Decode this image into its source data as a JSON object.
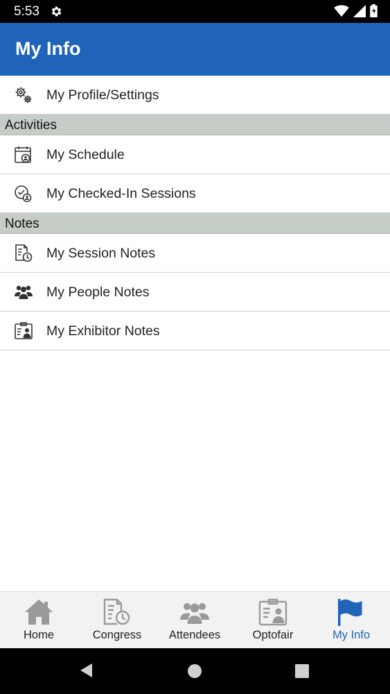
{
  "status_bar": {
    "time": "5:53"
  },
  "app_bar": {
    "title": "My Info"
  },
  "list": {
    "profile": {
      "label": "My Profile/Settings",
      "icon": "gears-icon"
    },
    "sections": [
      {
        "title": "Activities",
        "items": [
          {
            "label": "My Schedule",
            "icon": "calendar-person-icon"
          },
          {
            "label": "My Checked-In Sessions",
            "icon": "check-person-icon"
          }
        ]
      },
      {
        "title": "Notes",
        "items": [
          {
            "label": "My Session Notes",
            "icon": "note-clock-icon"
          },
          {
            "label": "My People Notes",
            "icon": "people-icon"
          },
          {
            "label": "My Exhibitor Notes",
            "icon": "exhibitor-card-icon"
          }
        ]
      }
    ]
  },
  "bottom_nav": {
    "tabs": [
      {
        "label": "Home",
        "icon": "home-icon"
      },
      {
        "label": "Congress",
        "icon": "note-clock-icon"
      },
      {
        "label": "Attendees",
        "icon": "people-icon"
      },
      {
        "label": "Optofair",
        "icon": "exhibitor-card-icon"
      },
      {
        "label": "My Info",
        "icon": "flag-icon",
        "active": true
      }
    ]
  },
  "colors": {
    "primary": "#1f64b9",
    "section_bg": "#c6cdc6",
    "icon_gray": "#9a9a9a"
  }
}
